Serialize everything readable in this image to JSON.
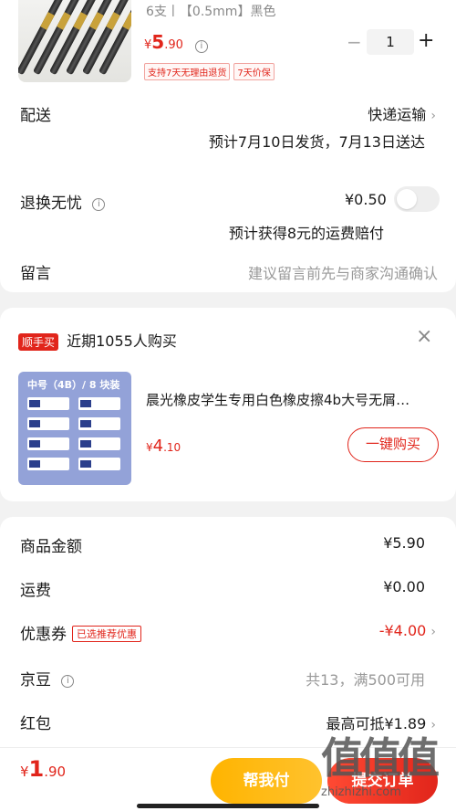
{
  "product": {
    "spec": "6支丨【0.5mm】黑色",
    "price_symbol": "¥",
    "price_int": "5",
    "price_dec": ".90",
    "quantity": "1",
    "minus": "−",
    "plus": "+",
    "tags": [
      "支持7天无理由退货",
      "7天价保"
    ]
  },
  "delivery": {
    "label": "配送",
    "method": "快递运输",
    "estimate": "预计7月10日发货，7月13日送达"
  },
  "return_insurance": {
    "label": "退换无忧",
    "price": "¥0.50",
    "note": "预计获得8元的运费赔付"
  },
  "message": {
    "label": "留言",
    "placeholder": "建议留言前先与商家沟通确认"
  },
  "recommend": {
    "badge": "顺手买",
    "title": "近期1055人购买",
    "close": "×",
    "item_title": "晨光橡皮学生专用白色橡皮擦4b大号无屑…",
    "price_symbol": "¥",
    "price_int": "4",
    "price_dec": ".10",
    "button": "一键购买",
    "image_header": "中号（4B）/ 8 块装"
  },
  "summary": {
    "goods_label": "商品金额",
    "goods_value": "¥5.90",
    "shipping_label": "运费",
    "shipping_value": "¥0.00",
    "coupon_label": "优惠券",
    "coupon_tag": "已选推荐优惠",
    "coupon_value": "-¥4.00",
    "beans_label": "京豆",
    "beans_value": "共13，满500可用",
    "redpacket_label": "红包",
    "redpacket_value": "最高可抵¥1.89"
  },
  "footer": {
    "total_symbol": "¥",
    "total_int": "1",
    "total_dec": ".90",
    "help_button": "帮我付",
    "pay_button": "提交订单"
  },
  "watermark": {
    "text": "值值值",
    "url": "zhizhizhi.com"
  },
  "colors": {
    "accent_red": "#e1251b",
    "help_yellow": "#ffb400"
  }
}
